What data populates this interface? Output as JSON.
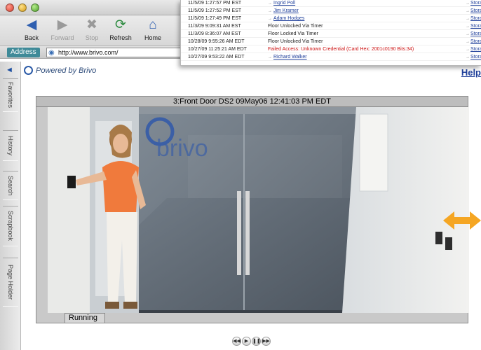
{
  "toolbar": {
    "back": "Back",
    "forward": "Forward",
    "stop": "Stop",
    "refresh": "Refresh",
    "home": "Home"
  },
  "address": {
    "label": "Address",
    "url": "http://www.brivo.com/"
  },
  "sidebar": {
    "tabs": [
      "Favorites",
      "History",
      "Search",
      "Scrapbook",
      "Page Holder"
    ]
  },
  "header": {
    "logo_text": "Powered by Brivo",
    "help": "Help"
  },
  "video": {
    "title": "3:Front Door DS2 09May06 12:41:03 PM EDT",
    "status": "Running"
  },
  "playback": {
    "buttons": [
      "rewind",
      "play",
      "pause",
      "fast-forward"
    ]
  },
  "log": {
    "rows": [
      {
        "time": "11/5/09 1:27:57 PM EST",
        "event": "Ingrid Poll",
        "type": "link",
        "storage": "Storag"
      },
      {
        "time": "11/5/09 1:27:52 PM EST",
        "event": "Jim Kramer",
        "type": "link",
        "storage": "Storag"
      },
      {
        "time": "11/5/09 1:27:49 PM EST",
        "event": "Adam Hodges",
        "type": "link",
        "storage": "Storag"
      },
      {
        "time": "11/3/09 9:09:31 AM EST",
        "event": "Floor Unlocked Via Timer",
        "type": "plain",
        "storage": "Storag"
      },
      {
        "time": "11/3/09 8:36:07 AM EST",
        "event": "Floor Locked Via Timer",
        "type": "plain",
        "storage": "Storag"
      },
      {
        "time": "10/28/09 9:55:26 AM EDT",
        "event": "Floor Unlocked Via Timer",
        "type": "plain",
        "storage": "Storag"
      },
      {
        "time": "10/27/09 11:25:21 AM EDT",
        "event": "Failed Access: Unknown Credential (Card Hex: 2001c0190 Bits:34)",
        "type": "alert",
        "storage": "Storag"
      },
      {
        "time": "10/27/09 9:53:22 AM EDT",
        "event": "Richard Walker",
        "type": "link",
        "storage": "Storag"
      }
    ]
  },
  "colors": {
    "accent": "#f5a623",
    "link": "#1f3f9a",
    "alert": "#cc1111"
  }
}
